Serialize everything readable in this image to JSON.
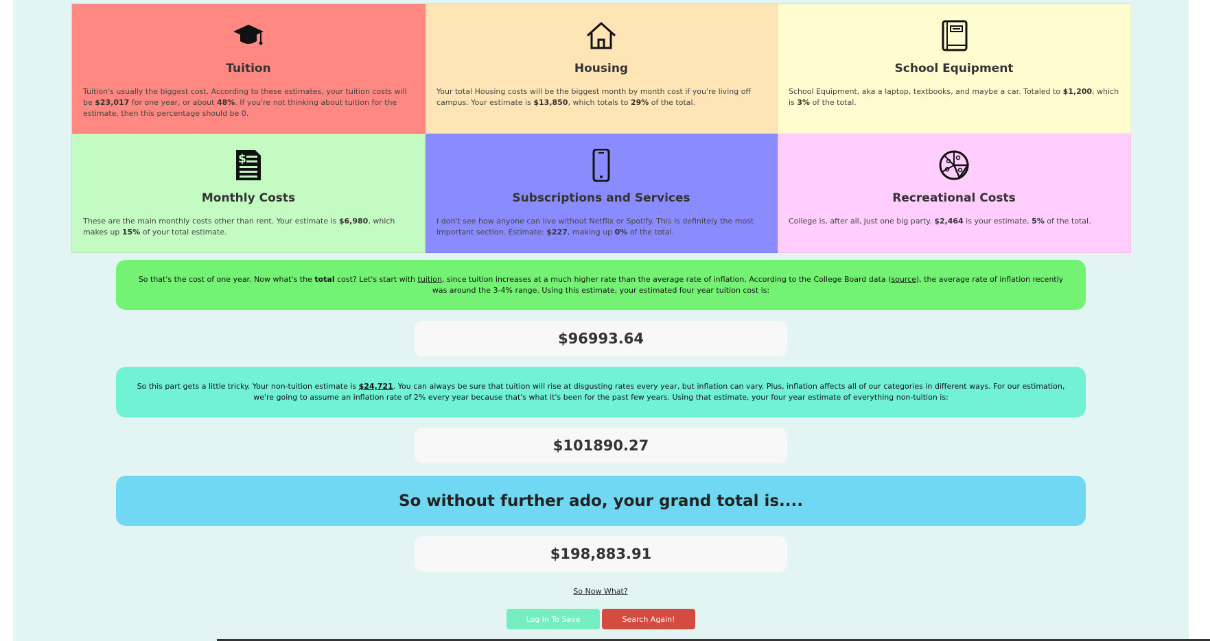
{
  "categories": [
    {
      "title": "Tuition",
      "icon": "graduation-cap-icon",
      "color": "#ff8882",
      "desc_parts": [
        "Tuition's usually the biggest cost. According to these estimates, your tuition costs will be ",
        "$23,017",
        " for one year, or about ",
        "48%",
        ". If you're not thinking about tuition for the estimate, then this percentage should be 0."
      ]
    },
    {
      "title": "Housing",
      "icon": "house-icon",
      "color": "#ffe5b6",
      "desc_parts": [
        "Your total Housing costs will be the biggest month by month cost if you're living off campus. Your estimate is ",
        "$13,850",
        ", which totals to ",
        "29%",
        " of the total."
      ]
    },
    {
      "title": "School Equipment",
      "icon": "book-icon",
      "color": "#fffdd0",
      "desc_parts": [
        "School Equipment, aka a laptop, textbooks, and maybe a car. Totaled to ",
        "$1,200",
        ", which is ",
        "3%",
        " of the total."
      ]
    },
    {
      "title": "Monthly Costs",
      "icon": "bill-icon",
      "color": "#c3fbc3",
      "desc_parts": [
        "These are the main monthly costs other than rent. Your estimate is ",
        "$6,980",
        ", which makes up ",
        "15%",
        " of your total estimate."
      ]
    },
    {
      "title": "Subscriptions and Services",
      "icon": "smartphone-icon",
      "color": "#8a8bff",
      "desc_parts": [
        "I don't see how anyone can live without Netflix or Spotify. This is definitely the most important section. Estimate: ",
        "$227",
        ", making up ",
        "0%",
        " of the total."
      ]
    },
    {
      "title": "Recreational Costs",
      "icon": "pizza-icon",
      "color": "#ffcdfe",
      "desc_parts": [
        "College is, after all, just one big party. ",
        "$2,464",
        " is your estimate, ",
        "5%",
        " of the total."
      ]
    }
  ],
  "tuition_banner": {
    "color": "#73f273",
    "t1": "So that's the cost of one year. Now what's the ",
    "bold": "total",
    "t2": " cost? Let's start with ",
    "link1": "tuition",
    "t3": ", since tuition increases at a much higher rate than the average rate of inflation. According to the College Board data (",
    "link2": "source",
    "t4": "), the average rate of inflation recently was around the 3-4% range. Using this estimate, your estimated four year tuition cost is:"
  },
  "tuition_total": "$96993.64",
  "nontuition_banner": {
    "color": "#72f2d5",
    "t1": "So this part gets a little tricky. Your non-tuition estimate is ",
    "link1": "$24,721",
    "t2": ". You can always be sure that tuition will rise at disgusting rates every year, but inflation can vary. Plus, inflation affects all of our categories in different ways. For our estimation, we're going to assume an inflation rate of 2% every year because that's what it's been for the past few years. Using that estimate, your four year estimate of everything non-tuition is:"
  },
  "nontuition_total": "$101890.27",
  "grand_banner": {
    "color": "#70d8f2",
    "text": "So without further ado, your grand total is...."
  },
  "grand_total": "$198,883.91",
  "now_what_link": "So Now What?",
  "buttons": {
    "login": "Log In To Save",
    "search": "Search Again!"
  }
}
